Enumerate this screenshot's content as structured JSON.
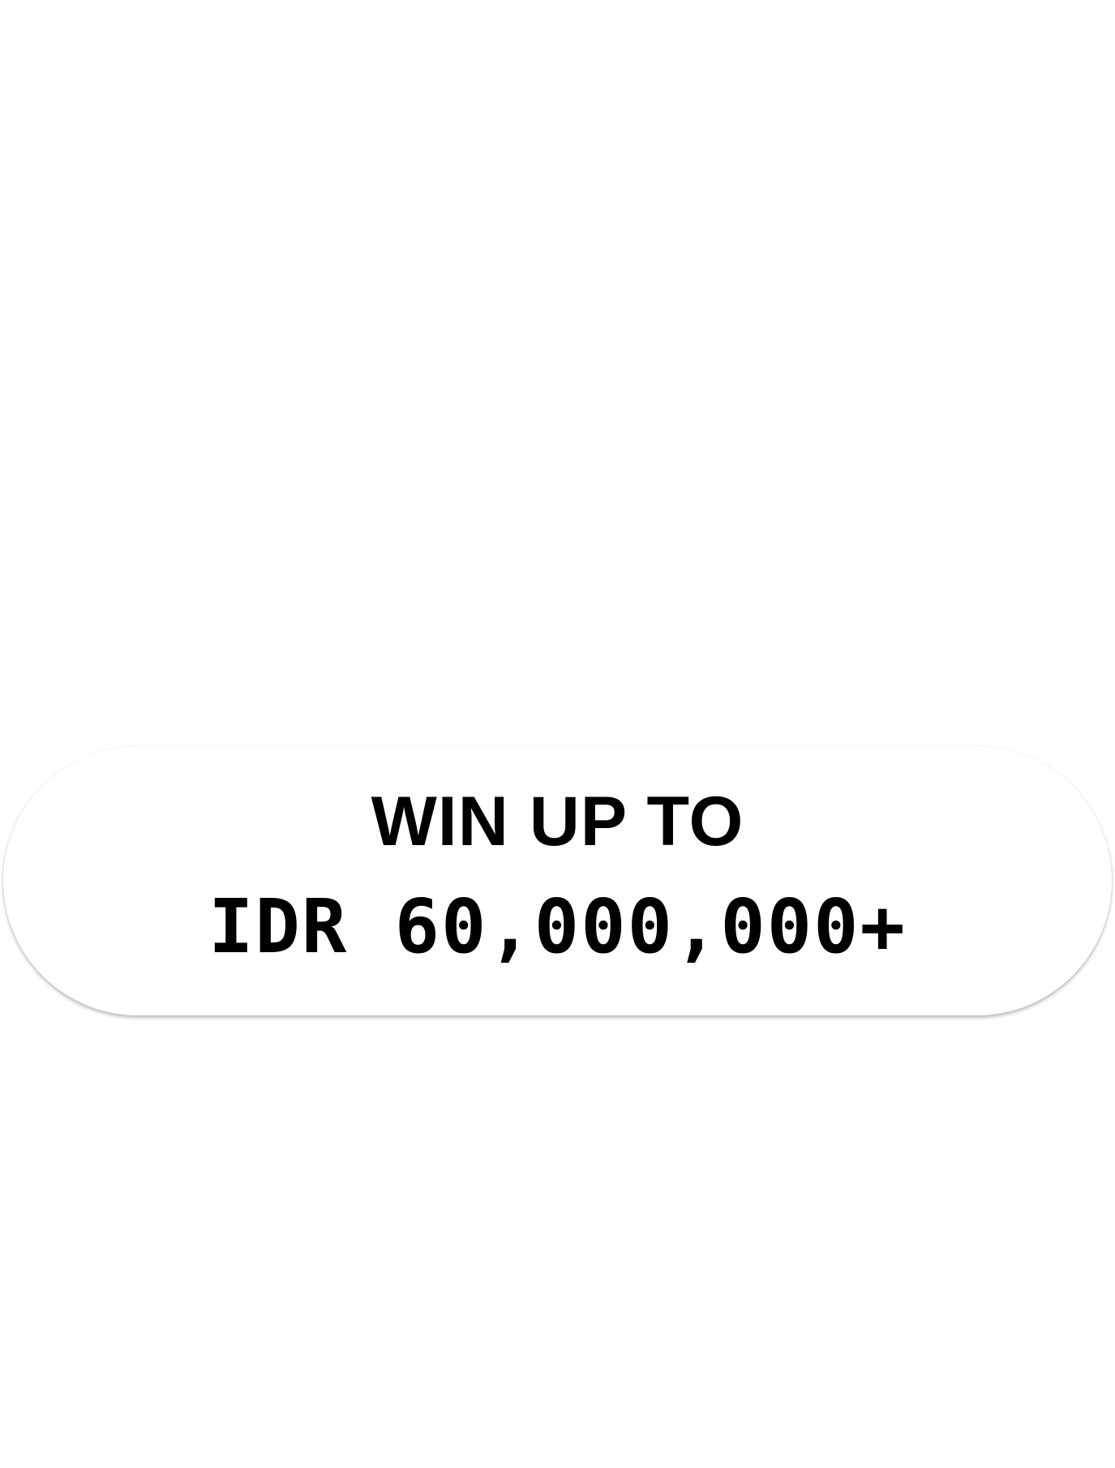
{
  "banner": {
    "line_1": "WIN UP TO",
    "line_2": "IDR 60,000,000+",
    "text_color": "#000000",
    "background_color": "#ffffff"
  }
}
